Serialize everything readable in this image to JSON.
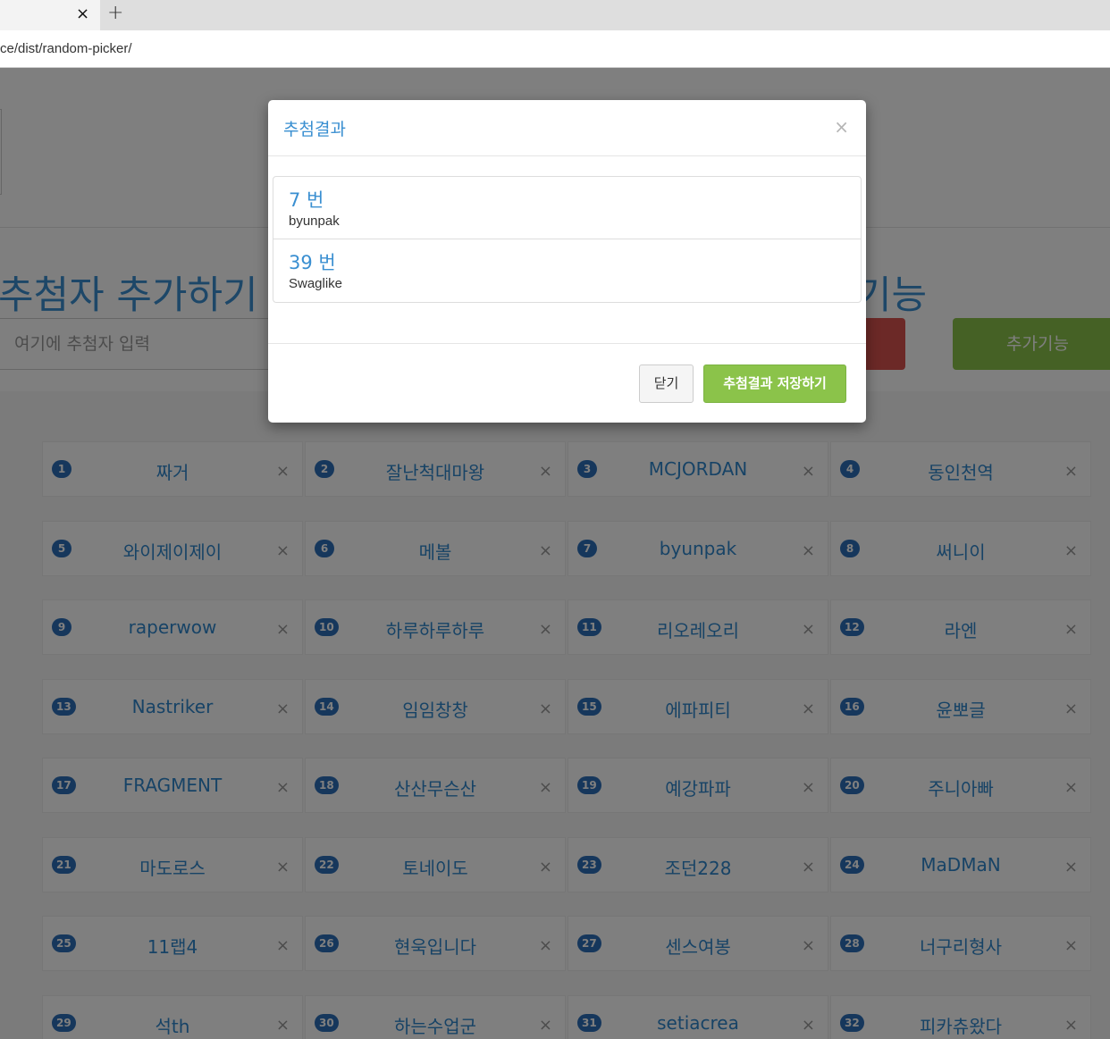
{
  "browser": {
    "tab_close": "×",
    "new_tab": "+",
    "address": "ce/dist/random-picker/"
  },
  "page": {
    "add_title": "추첨자 추가하기",
    "feature_title_fragment": "기능",
    "entry_placeholder": "여기에 추첨자 입력",
    "extra_button": "추가기능",
    "delete_symbol": "×",
    "entries": [
      {
        "num": "1",
        "name": "짜거"
      },
      {
        "num": "2",
        "name": "잘난척대마왕"
      },
      {
        "num": "3",
        "name": "MCJORDAN"
      },
      {
        "num": "4",
        "name": "동인천역"
      },
      {
        "num": "5",
        "name": "와이제이제이"
      },
      {
        "num": "6",
        "name": "메볼"
      },
      {
        "num": "7",
        "name": "byunpak"
      },
      {
        "num": "8",
        "name": "써니이"
      },
      {
        "num": "9",
        "name": "raperwow"
      },
      {
        "num": "10",
        "name": "하루하루하루"
      },
      {
        "num": "11",
        "name": "리오레오리"
      },
      {
        "num": "12",
        "name": "라엔"
      },
      {
        "num": "13",
        "name": "Nastriker"
      },
      {
        "num": "14",
        "name": "임임창창"
      },
      {
        "num": "15",
        "name": "에파피티"
      },
      {
        "num": "16",
        "name": "윤뽀글"
      },
      {
        "num": "17",
        "name": "FRAGMENT"
      },
      {
        "num": "18",
        "name": "산산무슨산"
      },
      {
        "num": "19",
        "name": "예강파파"
      },
      {
        "num": "20",
        "name": "주니아빠"
      },
      {
        "num": "21",
        "name": "마도로스"
      },
      {
        "num": "22",
        "name": "토네이도"
      },
      {
        "num": "23",
        "name": "조던228"
      },
      {
        "num": "24",
        "name": "MaDMaN"
      },
      {
        "num": "25",
        "name": "11랩4"
      },
      {
        "num": "26",
        "name": "현욱입니다"
      },
      {
        "num": "27",
        "name": "센스여봉"
      },
      {
        "num": "28",
        "name": "너구리형사"
      },
      {
        "num": "29",
        "name": "석th"
      },
      {
        "num": "30",
        "name": "하는수업군"
      },
      {
        "num": "31",
        "name": "setiacrea"
      },
      {
        "num": "32",
        "name": "피카츄왔다"
      }
    ]
  },
  "modal": {
    "title": "추첨결과",
    "close_symbol": "×",
    "results": [
      {
        "number": "7 번",
        "name": "byunpak"
      },
      {
        "number": "39 번",
        "name": "Swaglike"
      }
    ],
    "close_button": "닫기",
    "save_button": "추첨결과 저장하기"
  }
}
